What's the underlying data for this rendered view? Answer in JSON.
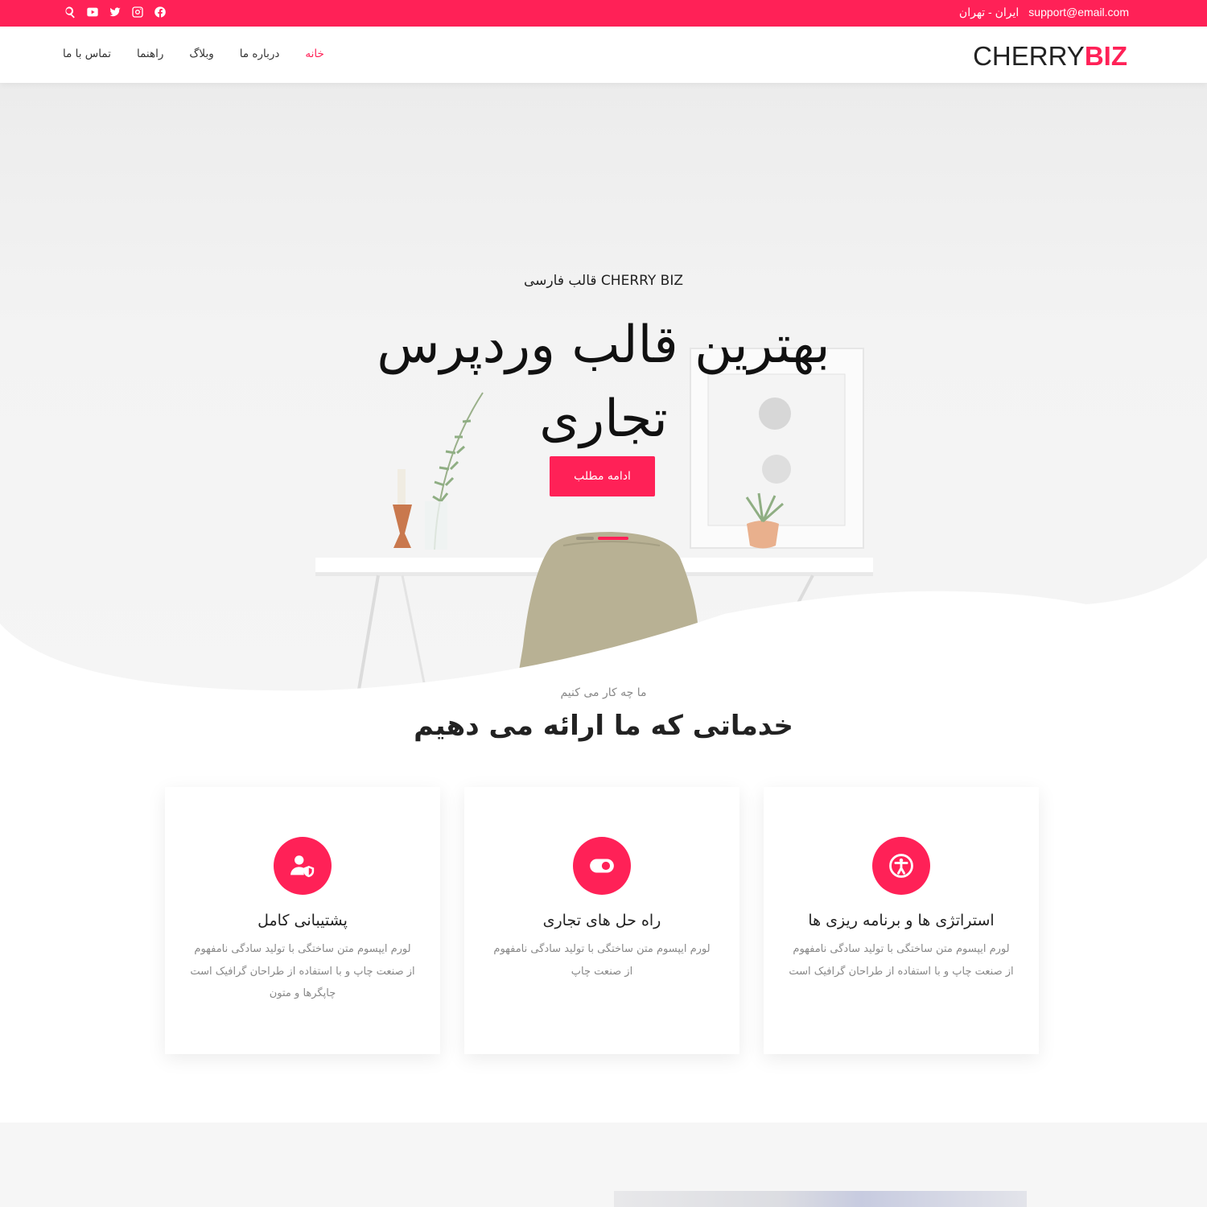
{
  "topbar": {
    "email": "support@email.com",
    "location": "ایران - تهران",
    "icons": [
      "facebook-icon",
      "instagram-icon",
      "twitter-icon",
      "youtube-icon",
      "search-icon"
    ]
  },
  "header": {
    "logo_part1": "CHERRY",
    "logo_part2": "BIZ",
    "nav": [
      "خانه",
      "درباره ما",
      "وبلاگ",
      "راهنما",
      "تماس با ما"
    ],
    "active_nav": "خانه"
  },
  "hero": {
    "subtitle": "قالب فارسی CHERRY BIZ",
    "title_line1": "بهترین قالب وردپرس",
    "title_line2": "تجاری",
    "button": "ادامه مطلب"
  },
  "services": {
    "subtitle": "ما چه کار می کنیم",
    "title": "خدماتی که ما ارائه می دهیم",
    "cards": [
      {
        "icon": "accessibility-icon",
        "title": "استراتژی ها و برنامه ریزی ها",
        "text": "لورم ایپسوم متن ساختگی با تولید سادگی نامفهوم از صنعت چاپ و با استفاده از طراحان گرافیک است"
      },
      {
        "icon": "toggle-icon",
        "title": "راه حل های تجاری",
        "text": "لورم ایپسوم متن ساختگی با تولید سادگی نامفهوم از صنعت چاپ"
      },
      {
        "icon": "user-shield-icon",
        "title": "پشتیبانی کامل",
        "text": "لورم ایپسوم متن ساختگی با تولید سادگی نامفهوم از صنعت چاپ و با استفاده از طراحان گرافیک است چاپگرها و متون"
      }
    ]
  },
  "colors": {
    "accent": "#ff2157",
    "text": "#222222",
    "muted": "#888888"
  }
}
